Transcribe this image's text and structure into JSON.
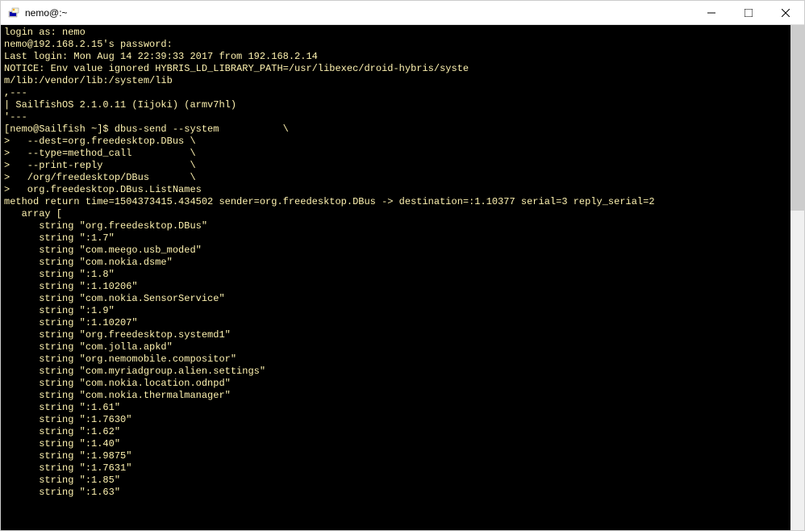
{
  "window": {
    "title": "nemo@:~"
  },
  "terminal": {
    "lines": [
      "login as: nemo",
      "nemo@192.168.2.15's password:",
      "Last login: Mon Aug 14 22:39:33 2017 from 192.168.2.14",
      "NOTICE: Env value ignored HYBRIS_LD_LIBRARY_PATH=/usr/libexec/droid-hybris/syste",
      "m/lib:/vendor/lib:/system/lib",
      ",---",
      "| SailfishOS 2.1.0.11 (Iijoki) (armv7hl)",
      "'---",
      "[nemo@Sailfish ~]$ dbus-send --system           \\",
      ">   --dest=org.freedesktop.DBus \\",
      ">   --type=method_call          \\",
      ">   --print-reply               \\",
      ">   /org/freedesktop/DBus       \\",
      ">   org.freedesktop.DBus.ListNames",
      "method return time=1504373415.434502 sender=org.freedesktop.DBus -> destination=:1.10377 serial=3 reply_serial=2",
      "   array [",
      "      string \"org.freedesktop.DBus\"",
      "      string \":1.7\"",
      "      string \"com.meego.usb_moded\"",
      "      string \"com.nokia.dsme\"",
      "      string \":1.8\"",
      "      string \":1.10206\"",
      "      string \"com.nokia.SensorService\"",
      "      string \":1.9\"",
      "      string \":1.10207\"",
      "      string \"org.freedesktop.systemd1\"",
      "      string \"com.jolla.apkd\"",
      "      string \"org.nemomobile.compositor\"",
      "      string \"com.myriadgroup.alien.settings\"",
      "      string \"com.nokia.location.odnpd\"",
      "      string \"com.nokia.thermalmanager\"",
      "      string \":1.61\"",
      "      string \":1.7630\"",
      "      string \":1.62\"",
      "      string \":1.40\"",
      "      string \":1.9875\"",
      "      string \":1.7631\"",
      "      string \":1.85\"",
      "      string \":1.63\""
    ]
  }
}
